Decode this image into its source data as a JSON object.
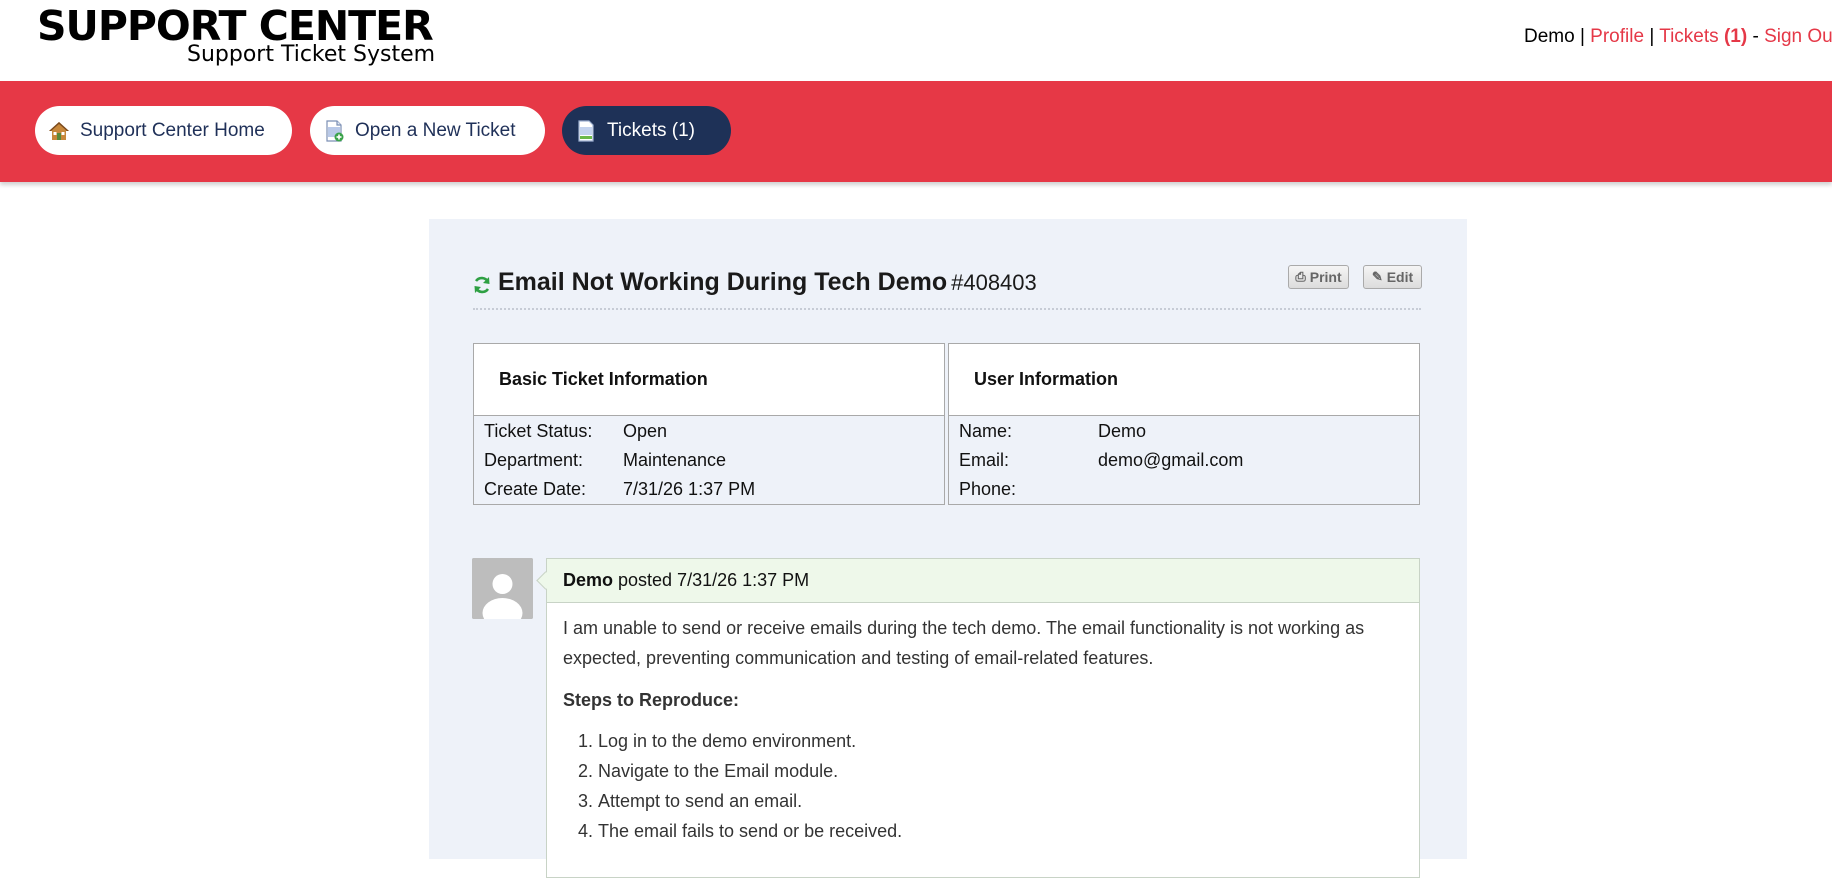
{
  "header": {
    "logo_main": "SUPPORT CENTER",
    "logo_sub": "Support Ticket System",
    "user_name": "Demo",
    "sep1": "|",
    "profile_link": "Profile",
    "sep2": "|",
    "tickets_link": "Tickets",
    "tickets_count": "(1)",
    "sep3": "-",
    "signout_link": "Sign Out"
  },
  "nav": {
    "items": [
      {
        "label": "Support Center Home",
        "icon": "home-icon"
      },
      {
        "label": "Open a New Ticket",
        "icon": "new-ticket-icon"
      },
      {
        "label": "Tickets (1)",
        "icon": "tickets-icon",
        "active": true
      }
    ]
  },
  "ticket": {
    "title": "Email Not Working During Tech Demo",
    "number": "#408403",
    "print_label": "Print",
    "edit_label": "Edit",
    "status_icon": "refresh-icon",
    "basic_info": {
      "heading": "Basic Ticket Information",
      "status_label": "Ticket Status:",
      "status_value": "Open",
      "department_label": "Department:",
      "department_value": "Maintenance",
      "create_date_label": "Create Date:",
      "create_date_value": "7/31/26 1:37 PM"
    },
    "user_info": {
      "heading": "User Information",
      "name_label": "Name:",
      "name_value": "Demo",
      "email_label": "Email:",
      "email_value": "demo@gmail.com",
      "phone_label": "Phone:",
      "phone_value": ""
    }
  },
  "thread": {
    "author": "Demo",
    "posted_text": "posted 7/31/26 1:37 PM",
    "body_paragraph": "I am unable to send or receive emails during the tech demo. The email functionality is not working as expected, preventing communication and testing of email-related features.",
    "steps_heading": "Steps to Reproduce:",
    "steps": [
      "Log in to the demo environment.",
      "Navigate to the Email module.",
      "Attempt to send an email.",
      "The email fails to send or be received."
    ]
  },
  "colors": {
    "brand_red": "#e63846",
    "nav_active": "#1e3157",
    "card_bg": "#eef2f9",
    "thread_head_bg": "#eef8ea"
  }
}
